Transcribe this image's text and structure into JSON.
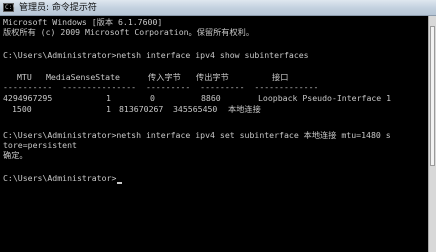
{
  "window": {
    "title": "管理员: 命令提示符",
    "icon": "cmd-icon"
  },
  "console": {
    "header_line1": "Microsoft Windows [版本 6.1.7600]",
    "header_line2": "版权所有 (c) 2009 Microsoft Corporation。保留所有权利。",
    "cmd1": "C:\\Users\\Administrator>netsh interface ipv4 show subinterfaces",
    "table": {
      "headers": [
        "MTU",
        "MediaSenseState",
        "传入字节",
        "传出字节",
        "接口"
      ],
      "separator": "----------  ---------------  ---------  ---------  -------------",
      "rows": [
        [
          "4294967295",
          "1",
          "0",
          "8860",
          "Loopback Pseudo-Interface 1"
        ],
        [
          "1500",
          "1",
          "813670267",
          "345565450",
          "本地连接"
        ]
      ]
    },
    "cmd2": "C:\\Users\\Administrator>netsh interface ipv4 set subinterface 本地连接 mtu=1480 s",
    "cmd2_cont": "tore=persistent",
    "result": "确定。",
    "prompt": "C:\\Users\\Administrator>"
  }
}
